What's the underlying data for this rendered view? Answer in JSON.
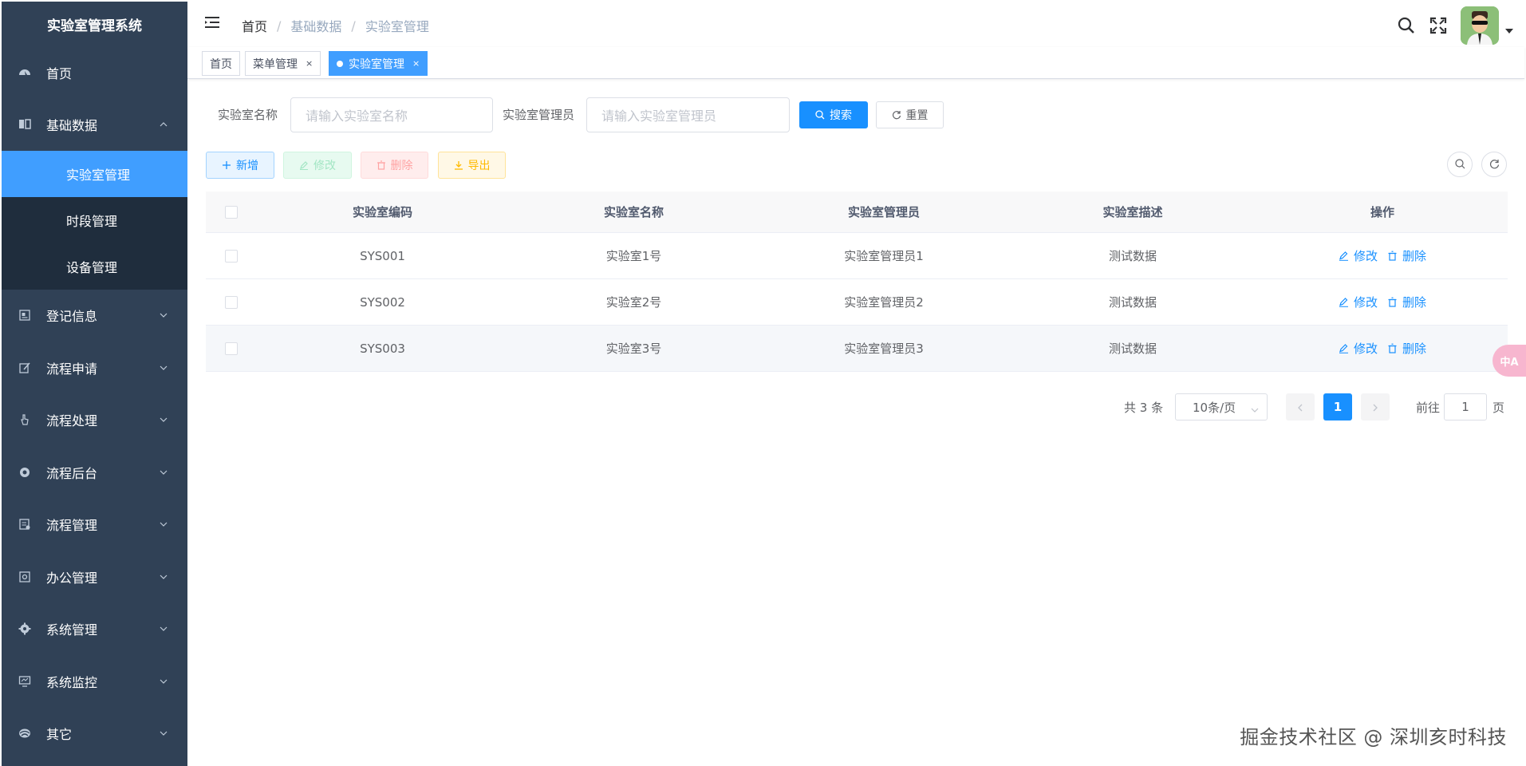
{
  "app": {
    "title": "实验室管理系统"
  },
  "sidebar": {
    "home": "首页",
    "menus": [
      {
        "label": "基础数据",
        "icon": "book-icon",
        "expanded": true
      },
      {
        "label": "登记信息",
        "icon": "form-icon"
      },
      {
        "label": "流程申请",
        "icon": "edit-icon"
      },
      {
        "label": "流程处理",
        "icon": "hand-icon"
      },
      {
        "label": "流程后台",
        "icon": "cog-ring-icon"
      },
      {
        "label": "流程管理",
        "icon": "clipboard-icon"
      },
      {
        "label": "办公管理",
        "icon": "monitor-icon"
      },
      {
        "label": "系统管理",
        "icon": "gear-icon"
      },
      {
        "label": "系统监控",
        "icon": "screen-icon"
      },
      {
        "label": "其它",
        "icon": "globe-icon"
      }
    ],
    "submenu": [
      "实验室管理",
      "时段管理",
      "设备管理"
    ]
  },
  "navbar": {
    "breadcrumb": [
      "首页",
      "基础数据",
      "实验室管理"
    ],
    "separator": "/"
  },
  "tags": [
    {
      "label": "首页"
    },
    {
      "label": "菜单管理",
      "close": "×"
    },
    {
      "label": "实验室管理",
      "close": "×",
      "active": true
    }
  ],
  "search": {
    "name_label": "实验室名称",
    "name_placeholder": "请输入实验室名称",
    "admin_label": "实验室管理员",
    "admin_placeholder": "请输入实验室管理员",
    "search_btn": "搜索",
    "reset_btn": "重置"
  },
  "toolbar": {
    "add": "新增",
    "edit": "修改",
    "delete": "删除",
    "export": "导出"
  },
  "table": {
    "headers": [
      "实验室编码",
      "实验室名称",
      "实验室管理员",
      "实验室描述",
      "操作"
    ],
    "rows": [
      {
        "code": "SYS001",
        "name": "实验室1号",
        "admin": "实验室管理员1",
        "desc": "测试数据"
      },
      {
        "code": "SYS002",
        "name": "实验室2号",
        "admin": "实验室管理员2",
        "desc": "测试数据"
      },
      {
        "code": "SYS003",
        "name": "实验室3号",
        "admin": "实验室管理员3",
        "desc": "测试数据"
      }
    ],
    "op_edit": "修改",
    "op_delete": "删除"
  },
  "pagination": {
    "total": "共 3 条",
    "page_size": "10条/页",
    "current": "1",
    "goto_label": "前往",
    "goto_value": "1",
    "page_suffix": "页"
  },
  "float_button": "中A",
  "watermark": "掘金技术社区 @ 深圳亥时科技",
  "colors": {
    "sidebar": "#304156",
    "submenu": "#1f2d3d",
    "primary": "#1890ff",
    "active_menu": "#409eff"
  }
}
